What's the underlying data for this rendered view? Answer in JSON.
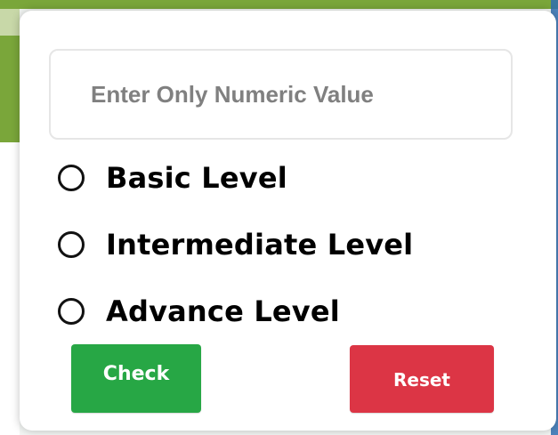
{
  "form": {
    "numeric_input": {
      "placeholder": "Enter Only Numeric Value",
      "value": ""
    },
    "levels": [
      {
        "label": "Basic Level",
        "selected": false
      },
      {
        "label": "Intermediate Level",
        "selected": false
      },
      {
        "label": "Advance Level",
        "selected": false
      }
    ],
    "check_label": "Check",
    "reset_label": "Reset"
  },
  "colors": {
    "check_button": "#27a745",
    "reset_button": "#dc3545"
  }
}
